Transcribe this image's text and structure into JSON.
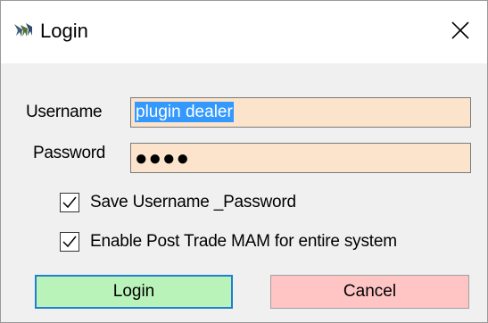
{
  "window": {
    "title": "Login",
    "app_icon": "app-logo-icon",
    "close_icon": "close-icon"
  },
  "form": {
    "username_label": "Username",
    "username_value": "plugin dealer",
    "password_label": "Password",
    "password_masked": "●●●●",
    "save_credentials": {
      "label": "Save Username _Password",
      "checked": true
    },
    "enable_mam": {
      "label": "Enable Post Trade MAM for entire system",
      "checked": true
    }
  },
  "buttons": {
    "login_label": "Login",
    "cancel_label": "Cancel"
  },
  "colors": {
    "input_bg": "#fce4cc",
    "selection": "#3399ff",
    "login_bg": "#b9f3b9",
    "login_border": "#1f7fd0",
    "cancel_bg": "#ffc4c4"
  }
}
